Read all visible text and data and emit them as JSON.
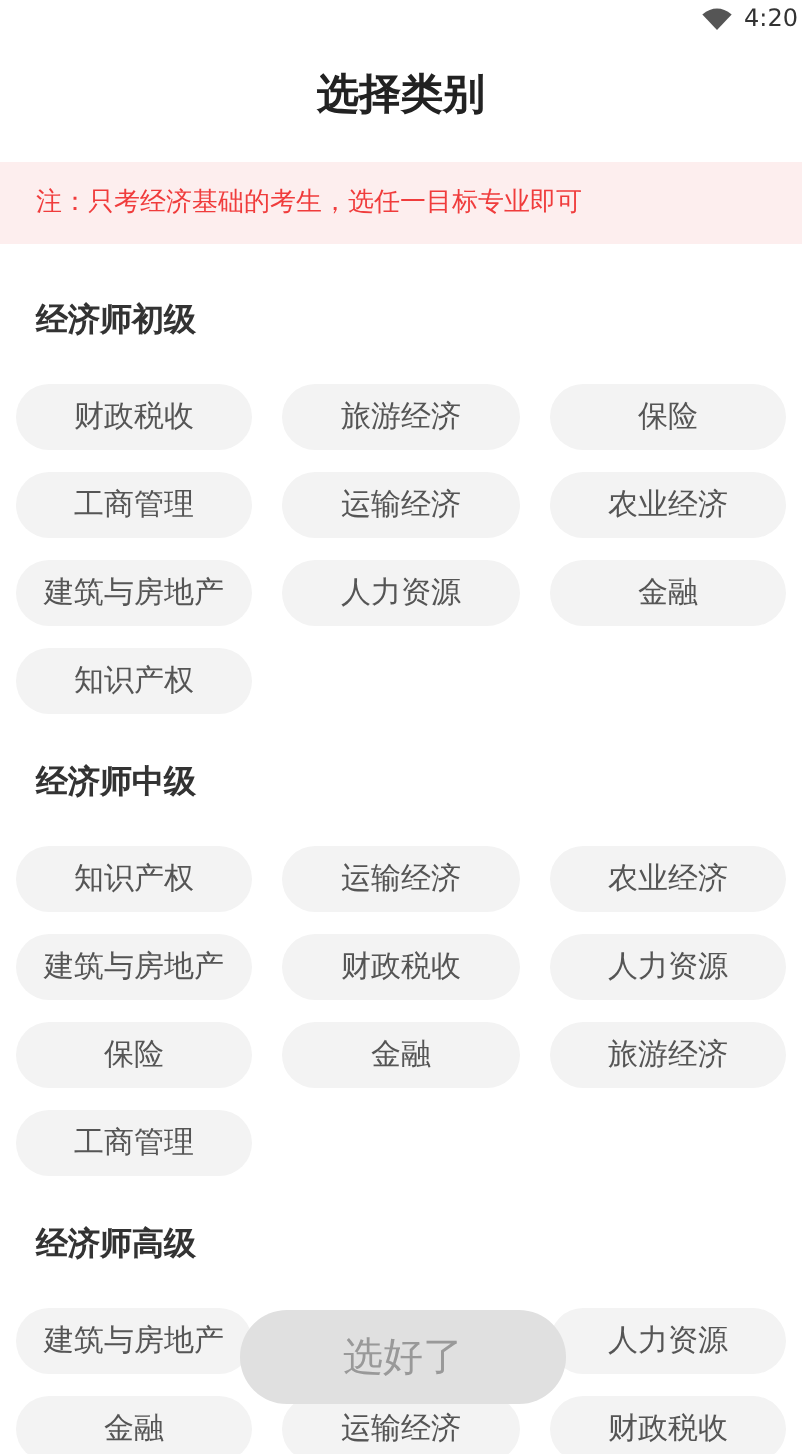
{
  "status_bar": {
    "time": "4:20"
  },
  "title": "选择类别",
  "notice": "注：只考经济基础的考生，选任一目标专业即可",
  "sections": [
    {
      "title": "经济师初级",
      "items": [
        {
          "kind": "chip",
          "label": "财政税收",
          "selected": false
        },
        {
          "kind": "chip",
          "label": "旅游经济",
          "selected": false
        },
        {
          "kind": "chip",
          "label": "保险",
          "selected": false
        },
        {
          "kind": "chip",
          "label": "工商管理",
          "selected": false
        },
        {
          "kind": "chip",
          "label": "运输经济",
          "selected": false
        },
        {
          "kind": "chip",
          "label": "农业经济",
          "selected": false
        },
        {
          "kind": "chip",
          "label": "建筑与房地产",
          "selected": false
        },
        {
          "kind": "chip",
          "label": "人力资源",
          "selected": false
        },
        {
          "kind": "chip",
          "label": "金融",
          "selected": false
        },
        {
          "kind": "chip",
          "label": "知识产权",
          "selected": false
        }
      ]
    },
    {
      "title": "经济师中级",
      "items": [
        {
          "kind": "chip",
          "label": "知识产权",
          "selected": false
        },
        {
          "kind": "chip",
          "label": "运输经济",
          "selected": false
        },
        {
          "kind": "chip",
          "label": "农业经济",
          "selected": false
        },
        {
          "kind": "chip",
          "label": "建筑与房地产",
          "selected": false
        },
        {
          "kind": "chip",
          "label": "财政税收",
          "selected": false
        },
        {
          "kind": "chip",
          "label": "人力资源",
          "selected": false
        },
        {
          "kind": "chip",
          "label": "保险",
          "selected": false
        },
        {
          "kind": "chip",
          "label": "金融",
          "selected": false
        },
        {
          "kind": "chip",
          "label": "旅游经济",
          "selected": false
        },
        {
          "kind": "chip",
          "label": "工商管理",
          "selected": false
        }
      ]
    },
    {
      "title": "经济师高级",
      "items": [
        {
          "kind": "chip",
          "label": "建筑与房地产",
          "selected": false
        },
        {
          "kind": "covered"
        },
        {
          "kind": "chip",
          "label": "人力资源",
          "selected": false
        },
        {
          "kind": "chip",
          "label": "金融",
          "selected": false
        },
        {
          "kind": "chip",
          "label": "运输经济",
          "selected": false
        },
        {
          "kind": "chip",
          "label": "财政税收",
          "selected": false
        }
      ]
    }
  ],
  "confirm_button": {
    "label": "选好了",
    "disabled": true
  }
}
